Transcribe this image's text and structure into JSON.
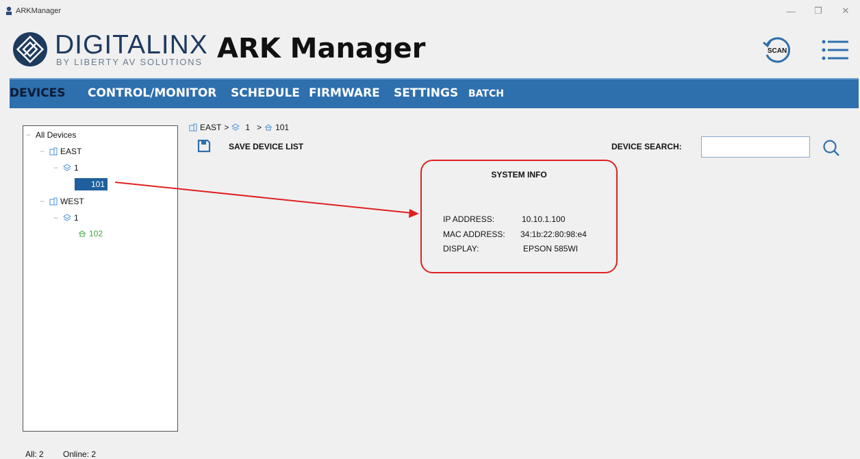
{
  "window": {
    "title": "ARKManager",
    "minimize_glyph": "—",
    "restore_glyph": "❐",
    "close_glyph": "✕"
  },
  "header": {
    "brand_name": "DIGITALINX",
    "brand_sub": "BY LIBERTY AV SOLUTIONS",
    "app_title": "ARK Manager",
    "scan_label": "SCAN",
    "colors": {
      "brand": "#1e3a5f",
      "nav_bg": "#2e6fae"
    }
  },
  "nav": {
    "items": [
      {
        "label": "DEVICES"
      },
      {
        "label": "CONTROL/MONITOR"
      },
      {
        "label": "SCHEDULE"
      },
      {
        "label": "FIRMWARE"
      },
      {
        "label": "SETTINGS"
      },
      {
        "label": "BATCH"
      }
    ],
    "active": "DEVICES"
  },
  "tree": {
    "root": "All Devices",
    "nodes": [
      {
        "label": "EAST",
        "icon": "building-icon"
      },
      {
        "label": "1",
        "icon": "layers-icon"
      },
      {
        "label": "101",
        "icon": "room-icon",
        "selected": true
      },
      {
        "label": "WEST",
        "icon": "building-icon"
      },
      {
        "label": "1",
        "icon": "layers-icon"
      },
      {
        "label": "102",
        "icon": "room-icon",
        "online_color": "#3aa63a"
      }
    ]
  },
  "breadcrumb": {
    "building": "EAST",
    "sep": ">",
    "floor": "1",
    "room": "101"
  },
  "toolbar": {
    "save_label": "SAVE DEVICE LIST",
    "search_label": "DEVICE SEARCH:",
    "search_value": ""
  },
  "system_info": {
    "title": "SYSTEM INFO",
    "rows": [
      {
        "key": "IP ADDRESS:",
        "value": "10.10.1.100"
      },
      {
        "key": "MAC ADDRESS:",
        "value": "34:1b:22:80:98:e4"
      },
      {
        "key": "DISPLAY:",
        "value": "EPSON 585WI"
      }
    ],
    "highlight_color": "#e02020"
  },
  "status": {
    "all": "All: 2",
    "online": "Online: 2"
  }
}
